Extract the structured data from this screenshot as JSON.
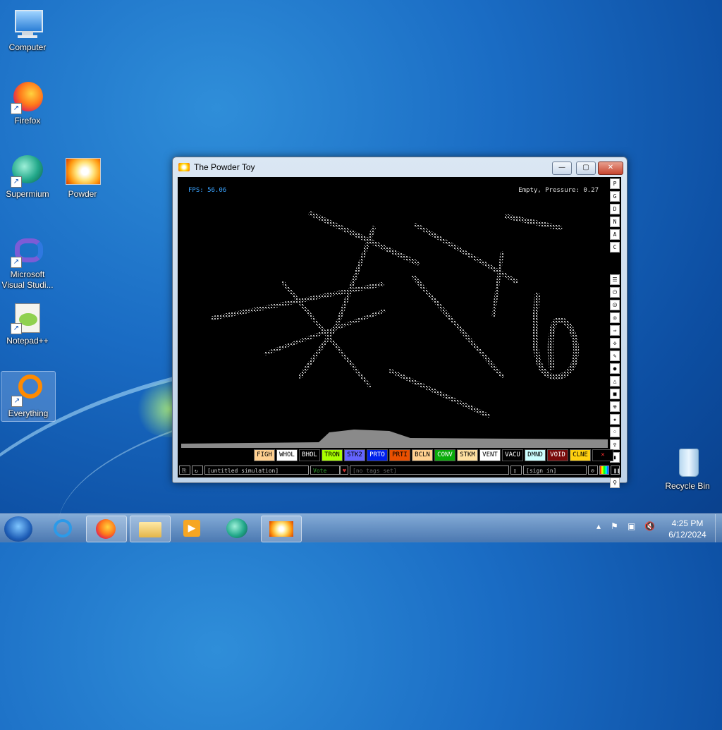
{
  "desktop_icons": [
    {
      "label": "Computer"
    },
    {
      "label": "Firefox"
    },
    {
      "label": "Supermium"
    },
    {
      "label": "Powder"
    },
    {
      "label": "Microsoft Visual Studi..."
    },
    {
      "label": "Notepad++"
    },
    {
      "label": "Everything"
    },
    {
      "label": "Recycle Bin"
    }
  ],
  "window": {
    "title": "The Powder Toy",
    "min": "—",
    "max": "▢",
    "close": "✕"
  },
  "game": {
    "fps": "FPS: 56.06",
    "status": "Empty, Pressure: 0.27",
    "top_buttons": [
      "P",
      "G",
      "D",
      "N",
      "A",
      "C"
    ],
    "side_icons": [
      "menu-icon",
      "power-icon",
      "power2-icon",
      "radio-icon",
      "arrow-icon",
      "tool-icon",
      "brush-icon",
      "drop-icon",
      "flask-icon",
      "square-icon",
      "radiation-icon",
      "star-icon",
      "dots-icon",
      "bulb-icon",
      "bookmark-icon",
      "wand-icon",
      "search-icon"
    ],
    "elements": [
      {
        "label": "FIGH",
        "bg": "#ffd090",
        "fg": "#000"
      },
      {
        "label": "WHOL",
        "bg": "#ffffff",
        "fg": "#000"
      },
      {
        "label": "BHOL",
        "bg": "#000000",
        "fg": "#fff"
      },
      {
        "label": "TRON",
        "bg": "#a9ff00",
        "fg": "#000"
      },
      {
        "label": "STK2",
        "bg": "#6464ff",
        "fg": "#000"
      },
      {
        "label": "PRTO",
        "bg": "#0020eb",
        "fg": "#fff"
      },
      {
        "label": "PRTI",
        "bg": "#eb5000",
        "fg": "#000"
      },
      {
        "label": "BCLN",
        "bg": "#ffd090",
        "fg": "#000"
      },
      {
        "label": "CONV",
        "bg": "#0aab0a",
        "fg": "#fff"
      },
      {
        "label": "STKM",
        "bg": "#ffe0a0",
        "fg": "#000"
      },
      {
        "label": "VENT",
        "bg": "#ffffff",
        "fg": "#000"
      },
      {
        "label": "VACU",
        "bg": "#000000",
        "fg": "#fff"
      },
      {
        "label": "DMND",
        "bg": "#ccffff",
        "fg": "#000"
      },
      {
        "label": "VOID",
        "bg": "#790b0b",
        "fg": "#fff"
      },
      {
        "label": "CLNE",
        "bg": "#ffd010",
        "fg": "#000"
      },
      {
        "label": "✕",
        "bg": "#000000",
        "fg": "#ff3030"
      }
    ],
    "bottom": {
      "sim_name": "[untitled simulation]",
      "vote": "Vote",
      "tags": "[no tags set]",
      "sign_in": "[sign in]"
    }
  },
  "taskbar": {
    "clock_time": "4:25 PM",
    "clock_date": "6/12/2024"
  }
}
